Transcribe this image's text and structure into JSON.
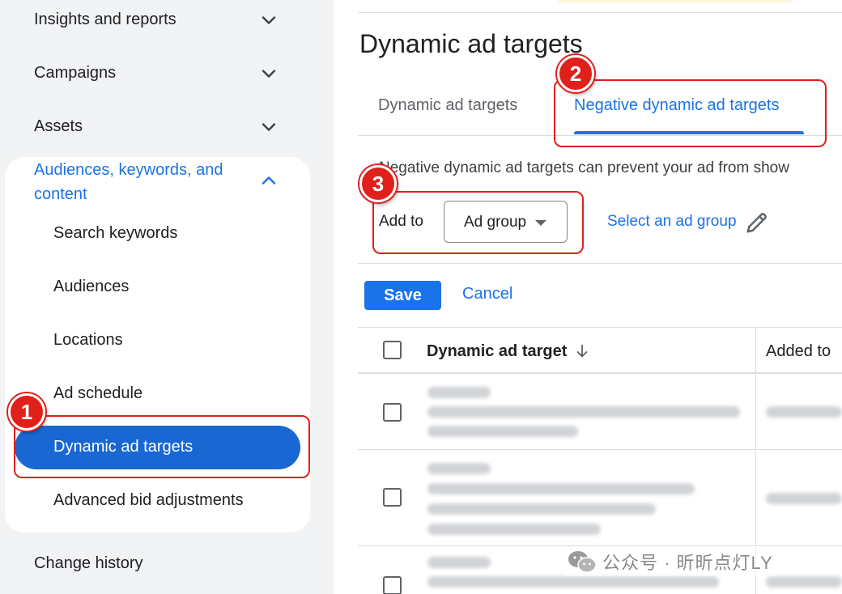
{
  "sidebar": {
    "top_items": [
      {
        "label": "Insights and reports"
      },
      {
        "label": "Campaigns"
      },
      {
        "label": "Assets"
      }
    ],
    "expanded_group": {
      "label": "Audiences, keywords, and content",
      "items": [
        {
          "label": "Search keywords"
        },
        {
          "label": "Audiences"
        },
        {
          "label": "Locations"
        },
        {
          "label": "Ad schedule"
        },
        {
          "label": "Dynamic ad targets",
          "active": true
        },
        {
          "label": "Advanced bid adjustments"
        }
      ]
    },
    "bottom_items": [
      {
        "label": "Change history"
      }
    ]
  },
  "annotations": {
    "step1": "1",
    "step2": "2",
    "step3": "3",
    "color": "#e0201b"
  },
  "main": {
    "title": "Dynamic ad targets",
    "tabs": [
      {
        "label": "Dynamic ad targets",
        "active": false
      },
      {
        "label": "Negative dynamic ad targets",
        "active": true
      }
    ],
    "description": "Negative dynamic ad targets can prevent your ad from show",
    "add_to": {
      "label": "Add to",
      "selected": "Ad group",
      "select_link": "Select an ad group"
    },
    "save_label": "Save",
    "cancel_label": "Cancel",
    "table": {
      "columns": [
        "Dynamic ad target",
        "Added to"
      ]
    }
  },
  "watermark": "公众号 · 昕昕点灯LY",
  "colors": {
    "accent": "#1a73e8",
    "active_nav": "#1967d2",
    "sidebar_bg": "#f1f3f4"
  }
}
